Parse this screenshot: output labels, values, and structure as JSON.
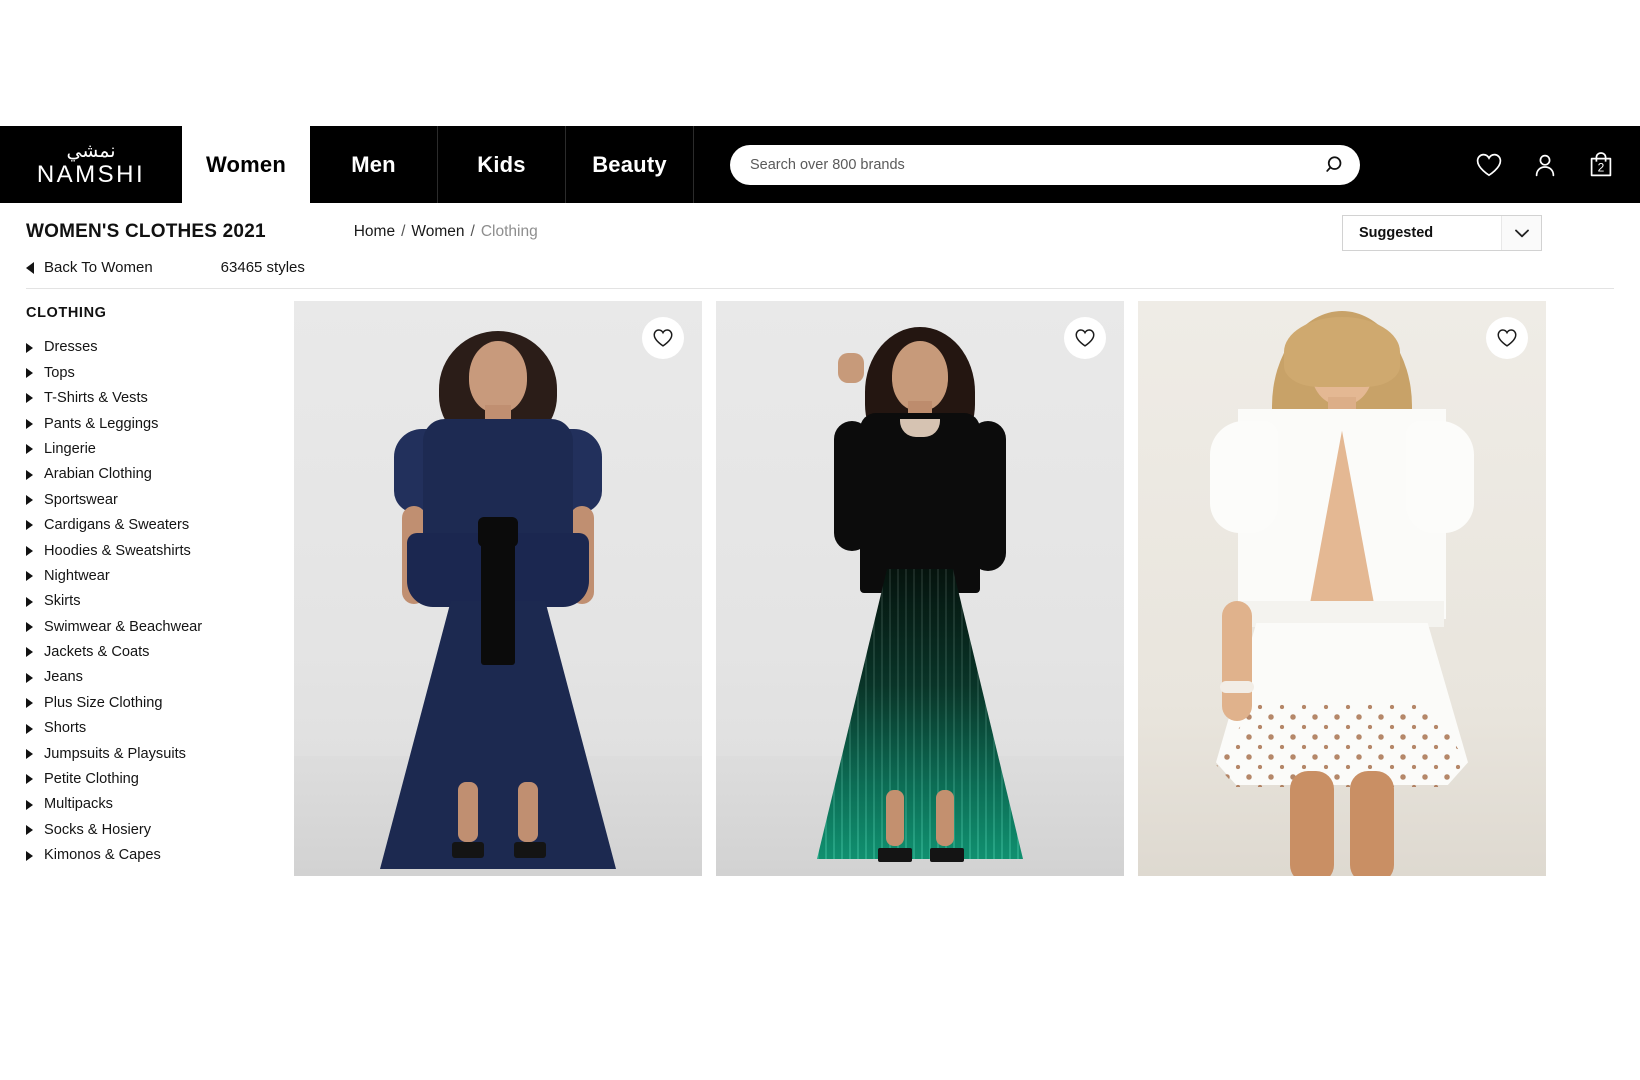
{
  "header": {
    "logo": {
      "arabic": "نمشي",
      "english": "NAMSHI"
    },
    "nav": [
      {
        "label": "Women",
        "active": true
      },
      {
        "label": "Men",
        "active": false
      },
      {
        "label": "Kids",
        "active": false
      },
      {
        "label": "Beauty",
        "active": false
      }
    ],
    "search": {
      "placeholder": "Search over 800 brands",
      "value": "",
      "icon": "search-icon"
    },
    "icons": [
      {
        "name": "wishlist-icon",
        "label": "Wishlist"
      },
      {
        "name": "account-icon",
        "label": "Account"
      },
      {
        "name": "bag-icon",
        "label": "Bag",
        "count": "2"
      }
    ]
  },
  "title_row": {
    "page_title": "WOMEN'S CLOTHES 2021",
    "breadcrumb": [
      {
        "label": "Home",
        "current": false
      },
      {
        "label": "Women",
        "current": false
      },
      {
        "label": "Clothing",
        "current": true
      }
    ],
    "separator": "/",
    "sort": {
      "selected": "Suggested",
      "icon": "chevron-down-icon"
    }
  },
  "sub_row": {
    "back_label": "Back To Women",
    "styles_count": "63465 styles"
  },
  "sidebar": {
    "heading": "CLOTHING",
    "items": [
      {
        "label": "Dresses"
      },
      {
        "label": "Tops"
      },
      {
        "label": "T-Shirts & Vests"
      },
      {
        "label": "Pants & Leggings"
      },
      {
        "label": "Lingerie"
      },
      {
        "label": "Arabian Clothing"
      },
      {
        "label": "Sportswear"
      },
      {
        "label": "Cardigans & Sweaters"
      },
      {
        "label": "Hoodies & Sweatshirts"
      },
      {
        "label": "Nightwear"
      },
      {
        "label": "Skirts"
      },
      {
        "label": "Swimwear & Beachwear"
      },
      {
        "label": "Jackets & Coats"
      },
      {
        "label": "Jeans"
      },
      {
        "label": "Plus Size Clothing"
      },
      {
        "label": "Shorts"
      },
      {
        "label": "Jumpsuits & Playsuits"
      },
      {
        "label": "Petite Clothing"
      },
      {
        "label": "Multipacks"
      },
      {
        "label": "Socks & Hosiery"
      },
      {
        "label": "Kimonos & Capes"
      }
    ]
  },
  "products": [
    {
      "alt": "Model wearing navy blue polka dot tulle midi dress with black bow sash",
      "wishlist_icon": "heart-icon"
    },
    {
      "alt": "Model wearing black cutout top with green pleated midi skirt",
      "wishlist_icon": "heart-icon"
    },
    {
      "alt": "Model wearing white broderie anglaise ruffled mini dress",
      "wishlist_icon": "heart-icon"
    }
  ],
  "colors": {
    "header_bg": "#000000",
    "accent_text": "#ffffff",
    "card_bg": "#e6e6e6",
    "breadcrumb_current": "#8e8e8e"
  }
}
